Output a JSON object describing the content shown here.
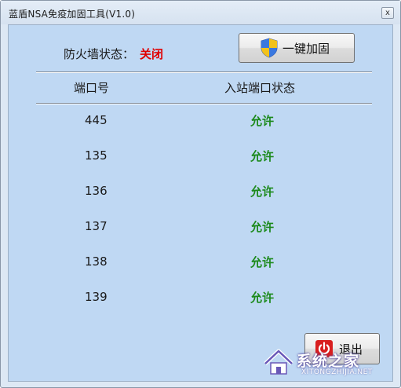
{
  "window": {
    "title": "蓝盾NSA免疫加固工具(V1.0)",
    "close_glyph": "x"
  },
  "firewall": {
    "label": "防火墙状态：",
    "status": "关闭",
    "status_color": "#e00000"
  },
  "buttons": {
    "harden_label": "一键加固",
    "harden_icon": "uac-shield-icon",
    "exit_label": "退出",
    "exit_icon": "power-icon"
  },
  "table": {
    "headers": [
      "端口号",
      "入站端口状态"
    ],
    "rows": [
      {
        "port": "445",
        "status": "允许"
      },
      {
        "port": "135",
        "status": "允许"
      },
      {
        "port": "136",
        "status": "允许"
      },
      {
        "port": "137",
        "status": "允许"
      },
      {
        "port": "138",
        "status": "允许"
      },
      {
        "port": "139",
        "status": "允许"
      }
    ],
    "status_color": "#1c8a1c"
  },
  "watermark": {
    "text": "系统之家",
    "url": "XITONGZHIJIA.NET"
  }
}
